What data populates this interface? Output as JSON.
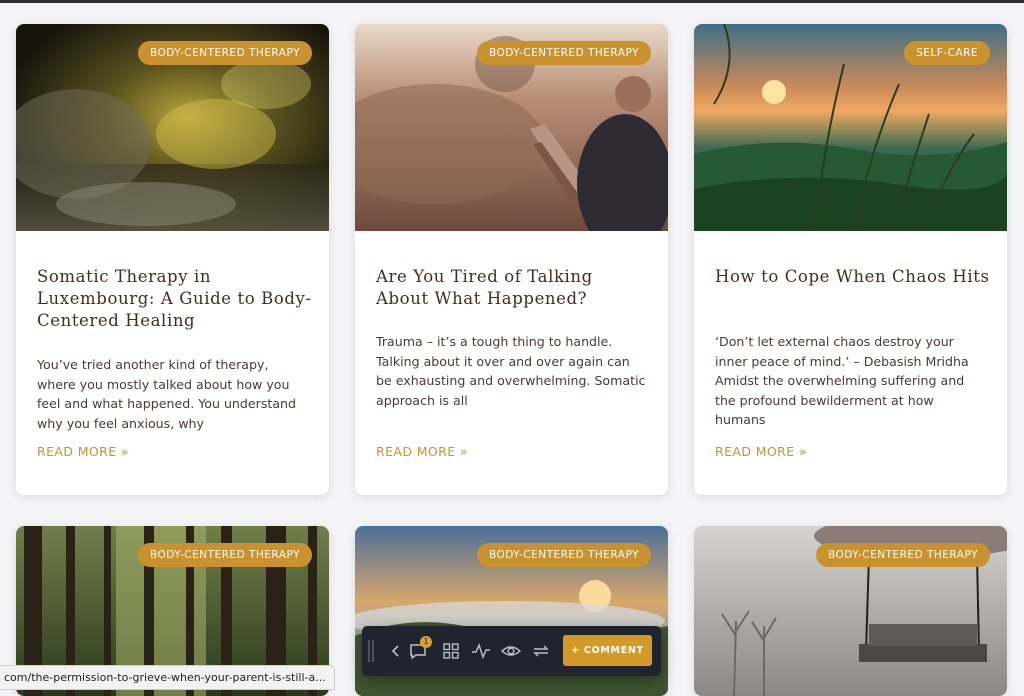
{
  "cards": [
    {
      "category": "BODY-CENTERED THERAPY",
      "title": "Somatic Therapy in Luxembourg: A Guide to Body-Centered Healing",
      "excerpt": "You’ve tried another kind of therapy, where you mostly talked about how you feel and what happened. You understand why you feel anxious, why",
      "read_more": "READ MORE »"
    },
    {
      "category": "BODY-CENTERED THERAPY",
      "title": "Are You Tired of Talking About What Happened?",
      "excerpt": "Trauma – it’s a tough thing to handle. Talking about it over and over again can be exhausting and overwhelming. Somatic approach is all",
      "read_more": "READ MORE »"
    },
    {
      "category": "SELF-CARE",
      "title": "How to Cope When Chaos Hits",
      "excerpt": "‘Don’t let external chaos destroy your inner peace of mind.’ – Debasish Mridha Amidst the overwhelming suffering and the profound bewilderment at how humans",
      "read_more": "READ MORE »"
    },
    {
      "category": "BODY-CENTERED THERAPY"
    },
    {
      "category": "BODY-CENTERED THERAPY"
    },
    {
      "category": "BODY-CENTERED THERAPY"
    }
  ],
  "status_url": "com/the-permission-to-grieve-when-your-parent-is-still-a...",
  "toolbar": {
    "notification_count": "1",
    "comment_label": "+ COMMENT",
    "icons": [
      "drag-handle-icon",
      "chevron-left-icon",
      "comment-bubble-icon",
      "grid-icon",
      "activity-icon",
      "eye-icon",
      "refresh-icon"
    ]
  },
  "colors": {
    "accent": "#c9922e",
    "title": "#4a2a1f",
    "text": "#4a3a38",
    "toolbar": "#20242e"
  }
}
